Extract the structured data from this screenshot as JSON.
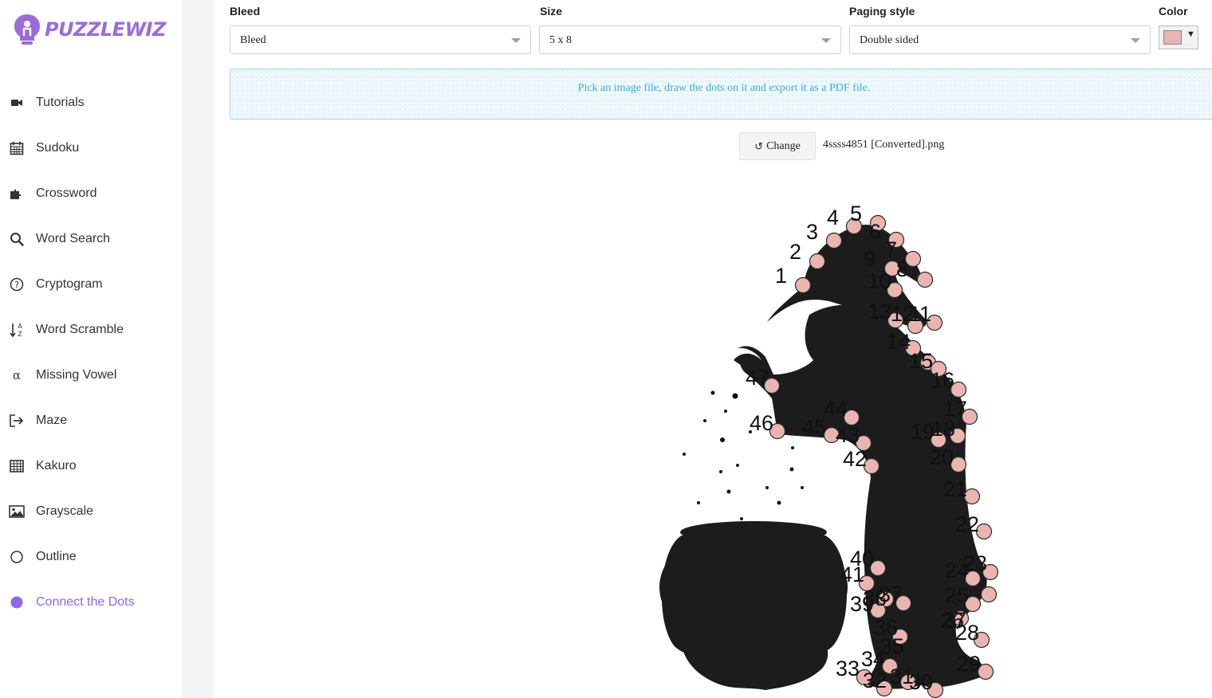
{
  "brand": {
    "name": "PUZZLEWIZ",
    "accent": "#9b6bdc"
  },
  "sidebar": {
    "items": [
      {
        "label": "Tutorials",
        "icon": "video-camera-icon"
      },
      {
        "label": "Sudoku",
        "icon": "calendar-grid-icon"
      },
      {
        "label": "Crossword",
        "icon": "puzzle-piece-icon"
      },
      {
        "label": "Word Search",
        "icon": "search-icon"
      },
      {
        "label": "Cryptogram",
        "icon": "question-circle-icon"
      },
      {
        "label": "Word Scramble",
        "icon": "sort-alpha-icon"
      },
      {
        "label": "Missing Vowel",
        "icon": "alpha-icon"
      },
      {
        "label": "Maze",
        "icon": "sign-in-icon"
      },
      {
        "label": "Kakuro",
        "icon": "table-icon"
      },
      {
        "label": "Grayscale",
        "icon": "image-icon"
      },
      {
        "label": "Outline",
        "icon": "circle-outline-icon"
      },
      {
        "label": "Connect the Dots",
        "icon": "circle-filled-icon",
        "active": true
      }
    ]
  },
  "settings": {
    "bleed": {
      "label": "Bleed",
      "value": "Bleed"
    },
    "size": {
      "label": "Size",
      "value": "5 x 8"
    },
    "paging": {
      "label": "Paging style",
      "value": "Double sided"
    },
    "color": {
      "label": "Color",
      "value": "#e8b4b4"
    }
  },
  "info_message": "Pick an image file, draw the dots on it and export it as a PDF file.",
  "file": {
    "change_label": "Change",
    "name": "4ssss4851 [Converted].png"
  },
  "puzzle": {
    "dot_labels": [
      "1",
      "2",
      "3",
      "4",
      "5",
      "6",
      "7",
      "8",
      "9",
      "10",
      "11",
      "12",
      "13",
      "14",
      "15",
      "16",
      "17",
      "18",
      "19",
      "20",
      "21",
      "22",
      "23",
      "24",
      "25",
      "26",
      "27",
      "28",
      "29",
      "30",
      "31",
      "32",
      "33",
      "34",
      "35",
      "36",
      "37",
      "38",
      "39",
      "40",
      "41",
      "42",
      "43",
      "44",
      "45",
      "46",
      "47"
    ]
  }
}
